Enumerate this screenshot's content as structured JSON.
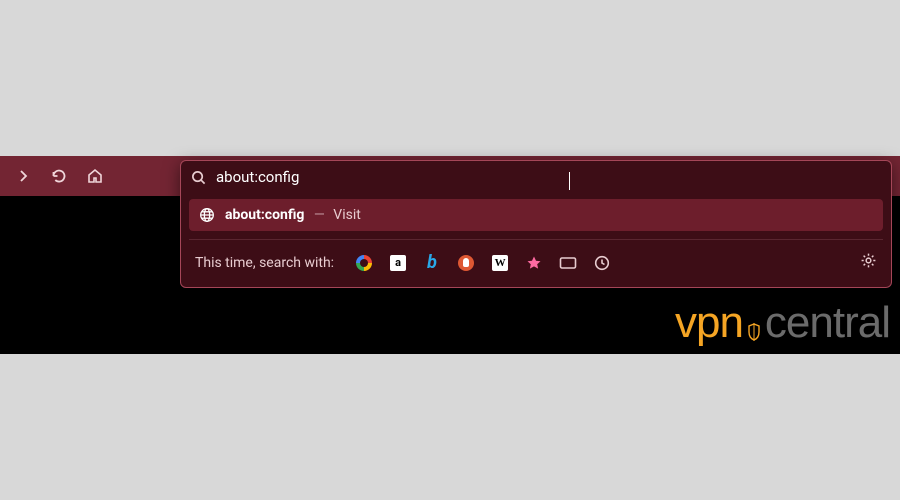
{
  "colors": {
    "toolbar_bg": "#732533",
    "dropdown_bg": "#3d0d16",
    "dropdown_border": "#a54658",
    "suggestion_bg": "#6d1e2c"
  },
  "toolbar": {
    "forward_icon": "arrow-right",
    "reload_icon": "reload",
    "home_icon": "home"
  },
  "urlbar": {
    "search_icon": "search",
    "value": "about:config"
  },
  "suggestion": {
    "icon": "globe",
    "text": "about:config",
    "separator": "—",
    "action": "Visit"
  },
  "engines": {
    "label": "This time, search with:",
    "list": [
      {
        "name": "Google"
      },
      {
        "name": "Amazon"
      },
      {
        "name": "Bing"
      },
      {
        "name": "DuckDuckGo"
      },
      {
        "name": "Wikipedia"
      },
      {
        "name": "Bookmarks"
      },
      {
        "name": "Tabs"
      },
      {
        "name": "History"
      }
    ],
    "settings_icon": "gear"
  },
  "watermark": {
    "part1": "vpn",
    "part2": "central"
  }
}
